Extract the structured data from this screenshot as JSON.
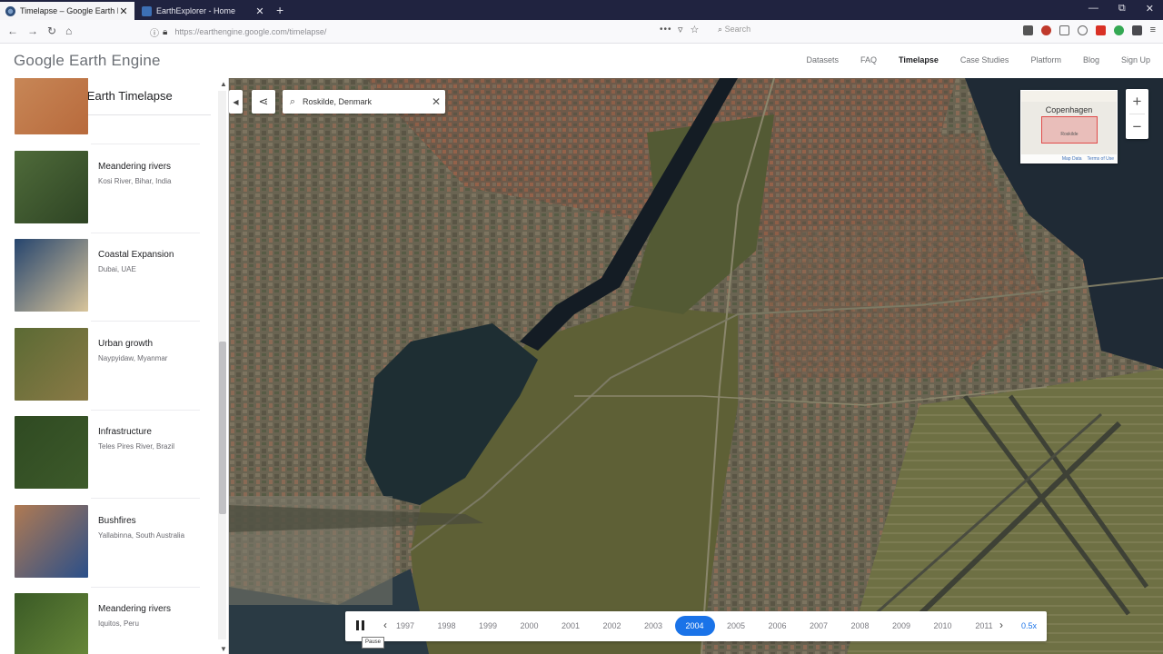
{
  "browser": {
    "tabs": [
      {
        "title": "Timelapse – Google Earth Engine"
      },
      {
        "title": "EarthExplorer - Home"
      }
    ],
    "url": "https://earthengine.google.com/timelapse/",
    "search_placeholder": "Search",
    "new_tab": "+",
    "icons": {
      "back": "back-arrow-icon",
      "forward": "forward-arrow-icon",
      "reload": "reload-icon",
      "home": "home-icon"
    }
  },
  "header": {
    "logo": "Google Earth Engine",
    "nav": [
      "Datasets",
      "FAQ",
      "Timelapse",
      "Case Studies",
      "Platform",
      "Blog",
      "Sign Up"
    ],
    "active_nav": "Timelapse"
  },
  "sidebar": {
    "title": "Google Earth Timelapse",
    "stories": [
      {
        "title": "",
        "subtitle": "",
        "colors": [
          "#c98a5a",
          "#b86a3c"
        ]
      },
      {
        "title": "Meandering rivers",
        "subtitle": "Kosi River, Bihar, India",
        "colors": [
          "#4f6b3a",
          "#2e4424"
        ]
      },
      {
        "title": "Coastal Expansion",
        "subtitle": "Dubai, UAE",
        "colors": [
          "#26456e",
          "#d8c49a"
        ]
      },
      {
        "title": "Urban growth",
        "subtitle": "Naypyidaw, Myanmar",
        "colors": [
          "#5b6a34",
          "#8a7a46"
        ]
      },
      {
        "title": "Infrastructure",
        "subtitle": "Teles Pires River, Brazil",
        "colors": [
          "#2f4a22",
          "#3d5a2a"
        ]
      },
      {
        "title": "Bushfires",
        "subtitle": "Yallabinna, South Australia",
        "colors": [
          "#b07a52",
          "#2a4f8a"
        ]
      },
      {
        "title": "Meandering rivers",
        "subtitle": "Iquitos, Peru",
        "colors": [
          "#3a5a26",
          "#6a8a3a"
        ]
      }
    ]
  },
  "map": {
    "search_value": "Roskilde, Denmark",
    "minimap": {
      "city": "Copenhagen",
      "box_label": "Roskilde",
      "footer": [
        "Map Data",
        "Terms of Use"
      ]
    },
    "zoom_in": "+",
    "zoom_out": "−"
  },
  "timeline": {
    "years": [
      "1997",
      "1998",
      "1999",
      "2000",
      "2001",
      "2002",
      "2003",
      "2004",
      "2005",
      "2006",
      "2007",
      "2008",
      "2009",
      "2010",
      "2011"
    ],
    "selected_year": "2004",
    "speed_label": "0.5x",
    "pause_tooltip": "Pause"
  }
}
